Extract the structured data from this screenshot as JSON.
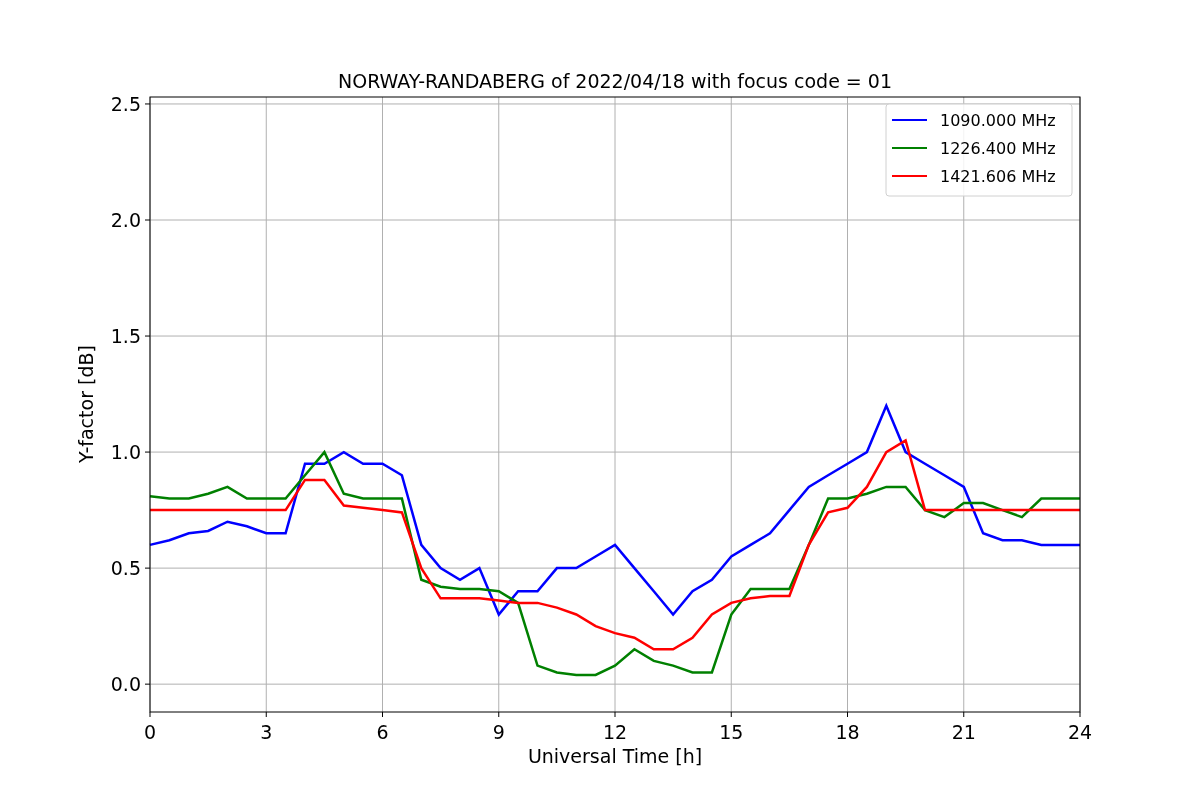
{
  "chart_data": {
    "type": "line",
    "title": "NORWAY-RANDABERG of 2022/04/18 with focus code = 01",
    "xlabel": "Universal Time [h]",
    "ylabel": "Y-factor [dB]",
    "x": [
      0,
      0.5,
      1,
      1.5,
      2,
      2.5,
      3,
      3.5,
      4,
      4.5,
      5,
      5.5,
      6,
      6.5,
      7,
      7.5,
      8,
      8.5,
      9,
      9.5,
      10,
      10.5,
      11,
      11.5,
      12,
      12.5,
      13,
      13.5,
      14,
      14.5,
      15,
      15.5,
      16,
      16.5,
      17,
      17.5,
      18,
      18.5,
      19,
      19.5,
      20,
      20.5,
      21,
      21.5,
      22,
      22.5,
      23,
      23.5,
      24
    ],
    "series": [
      {
        "name": "1090.000 MHz",
        "color": "#0000ff",
        "values": [
          0.6,
          0.62,
          0.65,
          0.66,
          0.7,
          0.68,
          0.65,
          0.65,
          0.95,
          0.95,
          1.0,
          0.95,
          0.95,
          0.9,
          0.6,
          0.5,
          0.45,
          0.5,
          0.3,
          0.4,
          0.4,
          0.5,
          0.5,
          0.55,
          0.6,
          0.5,
          0.4,
          0.3,
          0.4,
          0.45,
          0.55,
          0.6,
          0.65,
          0.75,
          0.85,
          0.9,
          0.95,
          1.0,
          1.2,
          1.0,
          0.95,
          0.9,
          0.85,
          0.65,
          0.62,
          0.62,
          0.6,
          0.6,
          0.6
        ]
      },
      {
        "name": "1226.400 MHz",
        "color": "#008000",
        "values": [
          0.81,
          0.8,
          0.8,
          0.82,
          0.85,
          0.8,
          0.8,
          0.8,
          0.9,
          1.0,
          0.82,
          0.8,
          0.8,
          0.8,
          0.45,
          0.42,
          0.41,
          0.41,
          0.4,
          0.35,
          0.08,
          0.05,
          0.04,
          0.04,
          0.08,
          0.15,
          0.1,
          0.08,
          0.05,
          0.05,
          0.3,
          0.41,
          0.41,
          0.41,
          0.6,
          0.8,
          0.8,
          0.82,
          0.85,
          0.85,
          0.75,
          0.72,
          0.78,
          0.78,
          0.75,
          0.72,
          0.8,
          0.8,
          0.8
        ]
      },
      {
        "name": "1421.606 MHz",
        "color": "#ff0000",
        "values": [
          0.75,
          0.75,
          0.75,
          0.75,
          0.75,
          0.75,
          0.75,
          0.75,
          0.88,
          0.88,
          0.77,
          0.76,
          0.75,
          0.74,
          0.5,
          0.37,
          0.37,
          0.37,
          0.36,
          0.35,
          0.35,
          0.33,
          0.3,
          0.25,
          0.22,
          0.2,
          0.15,
          0.15,
          0.2,
          0.3,
          0.35,
          0.37,
          0.38,
          0.38,
          0.6,
          0.74,
          0.76,
          0.85,
          1.0,
          1.05,
          0.75,
          0.75,
          0.75,
          0.75,
          0.75,
          0.75,
          0.75,
          0.75,
          0.75
        ]
      }
    ],
    "grid": true,
    "legend": true,
    "xlim": [
      0,
      24
    ],
    "ylim": [
      -0.12,
      2.53
    ],
    "xticks": [
      0,
      3,
      6,
      9,
      12,
      15,
      18,
      21,
      24
    ],
    "yticks": [
      {
        "value": 0,
        "label": "0.0"
      },
      {
        "value": 0.5,
        "label": "0.5"
      },
      {
        "value": 1,
        "label": "1.0"
      },
      {
        "value": 1.5,
        "label": "1.5"
      },
      {
        "value": 2,
        "label": "2.0"
      },
      {
        "value": 2.5,
        "label": "2.5"
      }
    ]
  }
}
